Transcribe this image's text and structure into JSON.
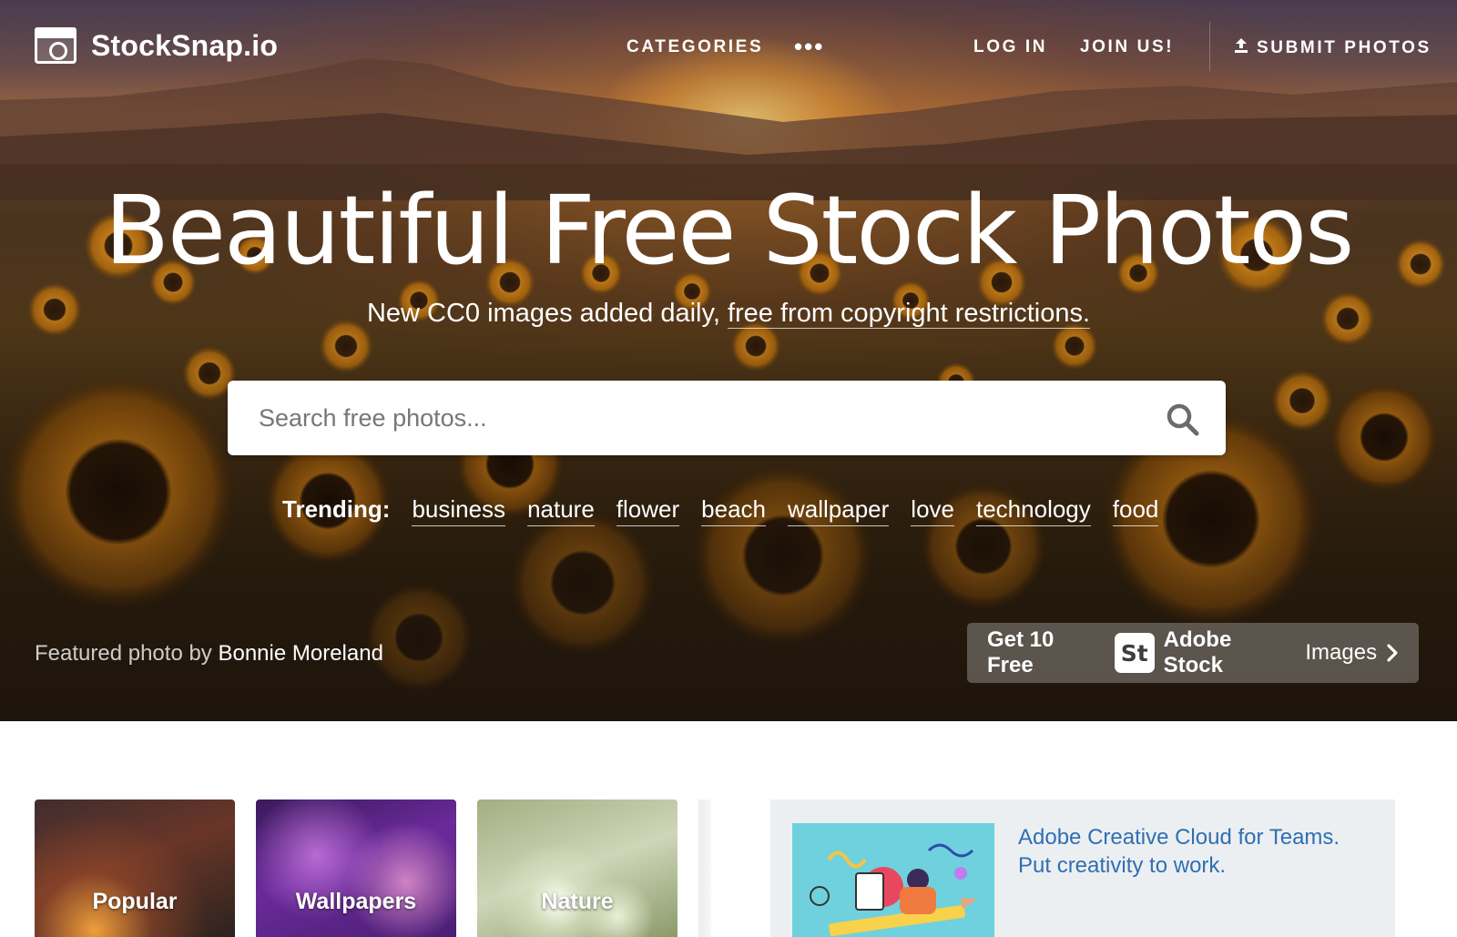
{
  "brand": {
    "name": "StockSnap.io"
  },
  "nav": {
    "categories": "CATEGORIES",
    "more": "•••",
    "login": "LOG IN",
    "join": "JOIN US!",
    "submit": "SUBMIT PHOTOS"
  },
  "hero": {
    "headline": "Beautiful Free Stock Photos",
    "sub_plain": "New CC0 images added daily, ",
    "sub_link": "free from copyright restrictions.",
    "search_placeholder": "Search free photos...",
    "trending_label": "Trending:",
    "trending": [
      "business",
      "nature",
      "flower",
      "beach",
      "wallpaper",
      "love",
      "technology",
      "food"
    ],
    "featured_prefix": "Featured photo by ",
    "featured_name": "Bonnie Moreland",
    "adobe": {
      "prefix": "Get 10 Free",
      "badge": "St",
      "brand": "Adobe Stock",
      "suffix": "Images"
    }
  },
  "categories": [
    {
      "label": "Popular"
    },
    {
      "label": "Wallpapers"
    },
    {
      "label": "Nature"
    }
  ],
  "ad": {
    "line1": "Adobe Creative Cloud for Teams.",
    "line2": "Put creativity to work."
  },
  "colors": {
    "ad_link": "#2f6fb3",
    "ad_bg": "#eceff1"
  }
}
